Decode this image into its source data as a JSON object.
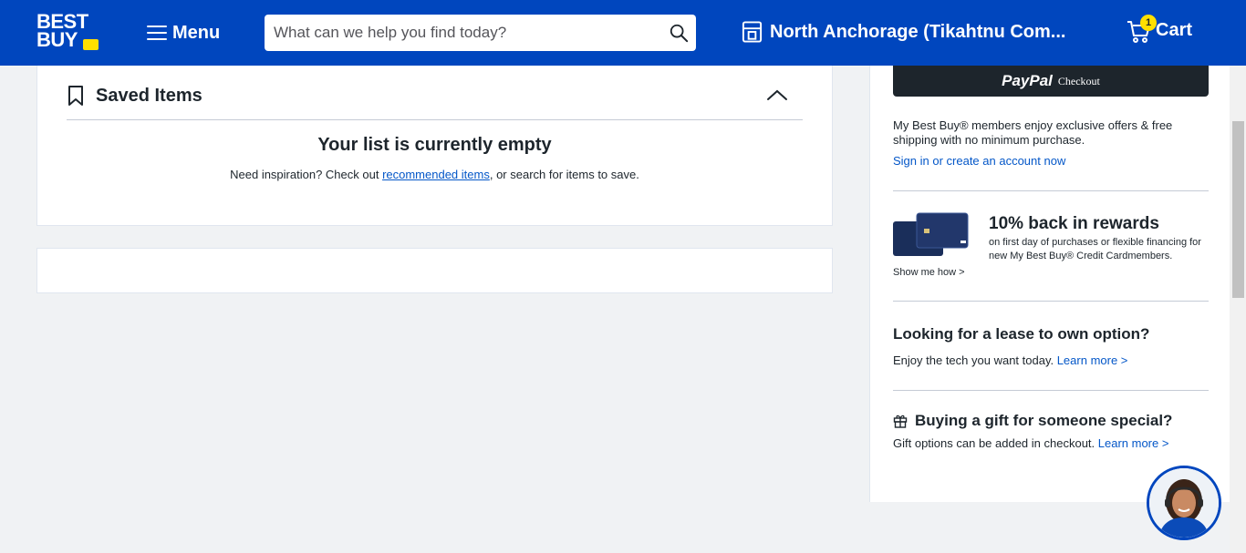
{
  "header": {
    "logo_line1": "BEST",
    "logo_line2": "BUY",
    "menu_label": "Menu",
    "search_placeholder": "What can we help you find today?",
    "store_label": "North Anchorage (Tikahtnu Com...",
    "cart_label": "Cart",
    "cart_count": "1",
    "brand_color": "#0046be",
    "accent_color": "#ffe000"
  },
  "saved_items": {
    "title": "Saved Items",
    "empty_title": "Your list is currently empty",
    "empty_text_before": "Need inspiration? Check out ",
    "empty_link": "recommended items",
    "empty_text_after": ", or search for items to save."
  },
  "sidebar": {
    "paypal_label": "PayPal",
    "paypal_checkout": "Checkout",
    "members_text": "My Best Buy® members enjoy exclusive offers & free shipping with no minimum purchase.",
    "sign_in_link": "Sign in or create an account now",
    "rewards_title": "10% back in rewards",
    "rewards_text": "on first day of purchases or flexible financing for new My Best Buy® Credit Cardmembers.",
    "show_me_link": "Show me how >",
    "lease_title": "Looking for a lease to own option?",
    "lease_text": "Enjoy the tech you want today. ",
    "lease_link": "Learn more >",
    "gift_title": "Buying a gift for someone special?",
    "gift_text": "Gift options can be added in checkout. ",
    "gift_link": "Learn more >"
  },
  "icons": {
    "search": "search-icon",
    "store": "store-icon",
    "cart": "cart-icon",
    "bookmark": "bookmark-icon",
    "collapse": "chevron-up-icon",
    "gift": "gift-icon",
    "chat": "chat-agent-avatar"
  }
}
